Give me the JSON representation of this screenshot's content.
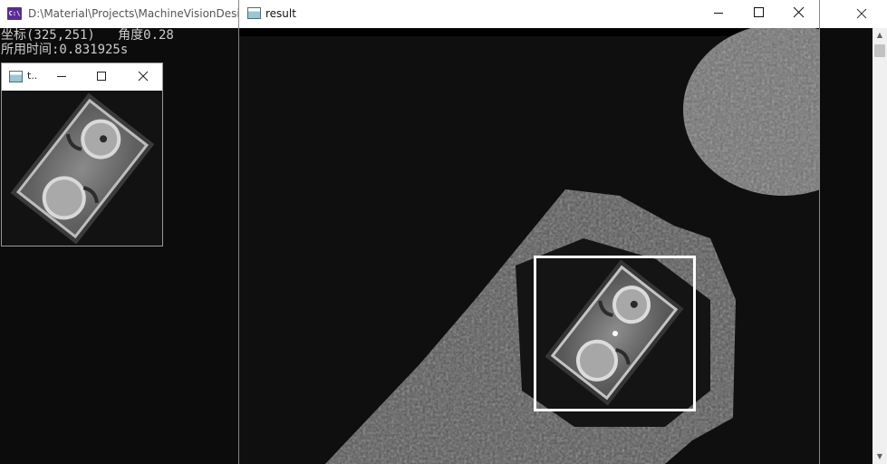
{
  "console": {
    "title": "D:\\Material\\Projects\\MachineVisionDesi",
    "icon": "console-icon",
    "icon_text": "C:\\",
    "lines": [
      "坐标(325,251)   角度0.28",
      "所用时间:0.831925s"
    ]
  },
  "template_window": {
    "title": "t..",
    "icon": "image-window-icon"
  },
  "result_window": {
    "title": "result",
    "icon": "image-window-icon"
  },
  "colors": {
    "console_bg": "#0c0c0c",
    "console_text": "#cccccc",
    "box": "#ffffff",
    "console_icon": "#5a2d91"
  }
}
